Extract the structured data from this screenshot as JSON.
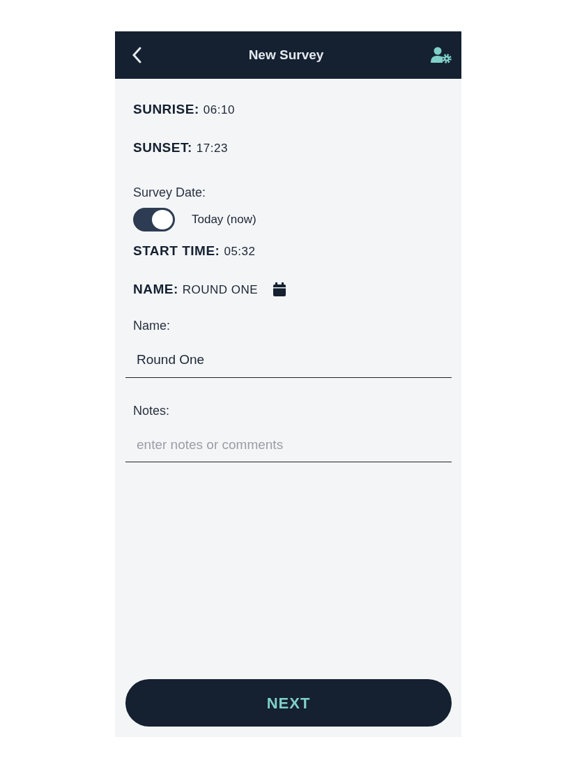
{
  "header": {
    "title": "New Survey"
  },
  "info": [
    {
      "label": "SUNRISE:",
      "value": "06:10"
    },
    {
      "label": "SUNSET:",
      "value": "17:23"
    }
  ],
  "survey_date": {
    "label": "Survey Date:",
    "toggle": {
      "on": true,
      "label": "Today (now)"
    }
  },
  "start_time": {
    "label": "START TIME:",
    "value": "05:32"
  },
  "name_line": {
    "label": "NAME:",
    "value": "ROUND ONE"
  },
  "fields": [
    {
      "label": "Name:",
      "value": "Round One"
    },
    {
      "label": "Notes:",
      "placeholder": "enter notes or comments"
    }
  ],
  "next_button": "NEXT"
}
